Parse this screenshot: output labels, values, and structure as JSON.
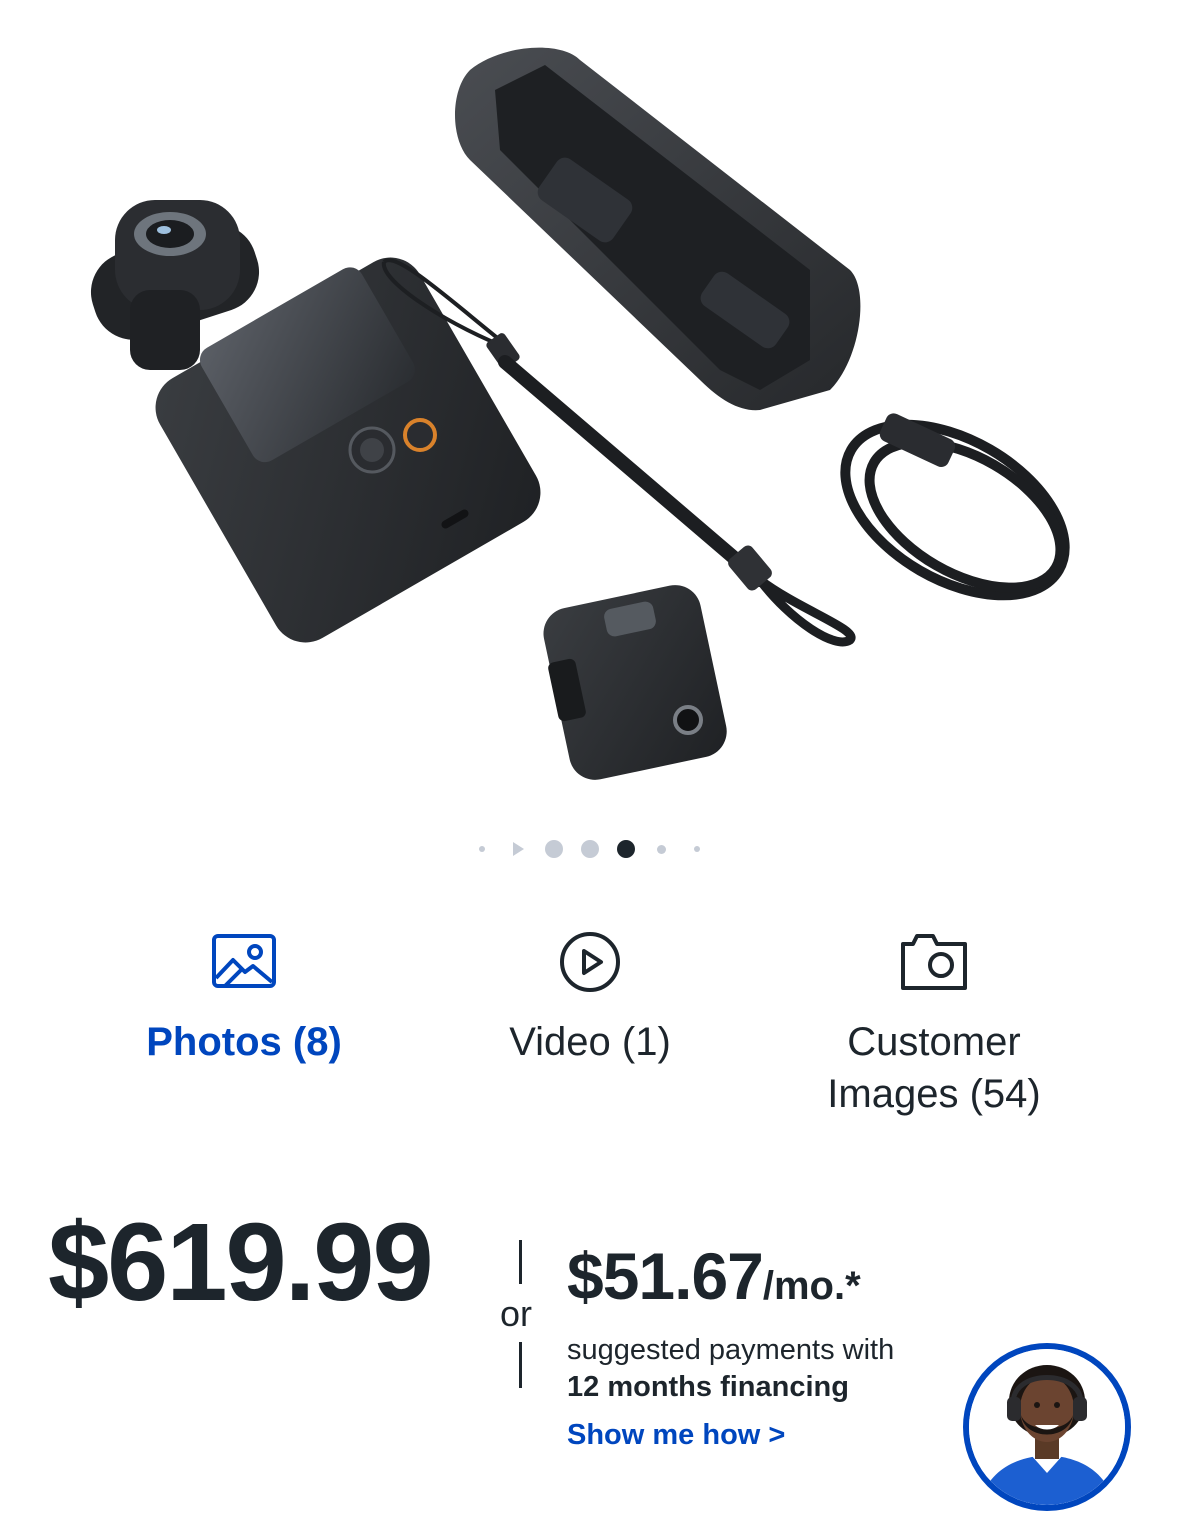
{
  "product_image": {
    "alt": "",
    "icon": "dji-pocket-3-kit-image"
  },
  "carousel": {
    "slide_count": 7,
    "active_index": 4
  },
  "media_tabs": [
    {
      "id": "photos",
      "label": "Photos (8)",
      "icon": "image-icon",
      "active": true
    },
    {
      "id": "video",
      "label": "Video (1)",
      "icon": "play-circle-icon",
      "active": false
    },
    {
      "id": "customer",
      "label_line1": "Customer",
      "label_line2": "Images (54)",
      "icon": "camera-icon",
      "active": false
    }
  ],
  "pricing": {
    "price": "$619.99",
    "or_text": "or",
    "monthly_amount": "$51.67",
    "monthly_suffix": "/mo.*",
    "financing_line1": "suggested payments with",
    "financing_line2": "12 months financing",
    "link_text": "Show me how >"
  },
  "colors": {
    "accent": "#0046be",
    "text": "#1d252c",
    "dot_inactive": "#c5cbd5"
  },
  "chat_agent": {
    "icon": "agent-avatar"
  }
}
